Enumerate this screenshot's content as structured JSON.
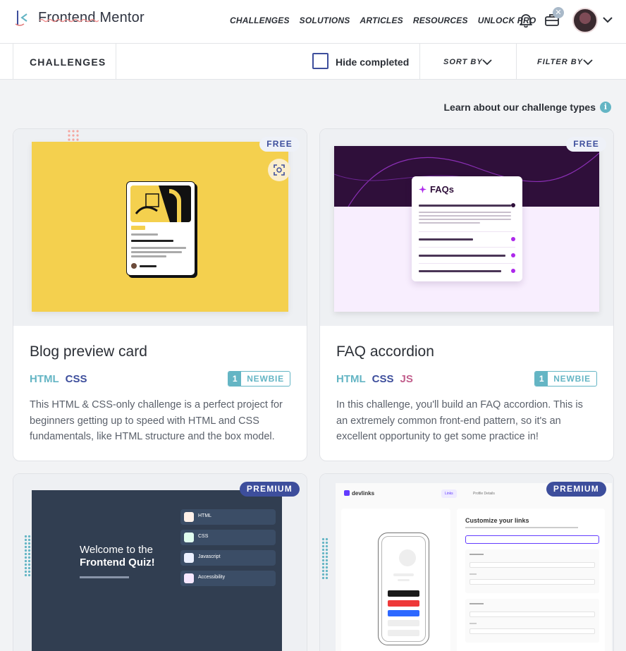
{
  "header": {
    "brand": "Frontend Mentor",
    "nav": [
      "CHALLENGES",
      "SOLUTIONS",
      "ARTICLES",
      "RESOURCES",
      "UNLOCK PRO"
    ],
    "close_badge": "✕"
  },
  "toolbar": {
    "title": "CHALLENGES",
    "hide_completed": "Hide completed",
    "sort_by": "SORT BY",
    "filter_by": "FILTER BY"
  },
  "learn": {
    "text": "Learn about our challenge types",
    "icon": "i"
  },
  "colors": {
    "primary": "#3d4e9c",
    "teal": "#64b5c4",
    "pink": "#c25e8c"
  },
  "cards": [
    {
      "badge": "FREE",
      "title": "Blog preview card",
      "languages": [
        "HTML",
        "CSS"
      ],
      "level_num": "1",
      "level_name": "NEWBIE",
      "description": "This HTML & CSS-only challenge is a perfect project for beginners getting up to speed with HTML and CSS fundamentals, like HTML structure and the box model."
    },
    {
      "badge": "FREE",
      "title": "FAQ accordion",
      "languages": [
        "HTML",
        "CSS",
        "JS"
      ],
      "level_num": "1",
      "level_name": "NEWBIE",
      "description": "In this challenge, you'll build an FAQ accordion. This is an extremely common front-end pattern, so it's an excellent opportunity to get some practice in!",
      "preview_title": "FAQs"
    },
    {
      "badge": "PREMIUM",
      "preview_title_line1": "Welcome to the",
      "preview_title_line2": "Frontend Quiz!",
      "preview_options": [
        "HTML",
        "CSS",
        "Javascript",
        "Accessibility"
      ]
    },
    {
      "badge": "PREMIUM",
      "preview_logo": "devlinks",
      "preview_tabs": [
        "Links",
        "Profile Details"
      ],
      "preview_heading": "Customize your links"
    }
  ]
}
